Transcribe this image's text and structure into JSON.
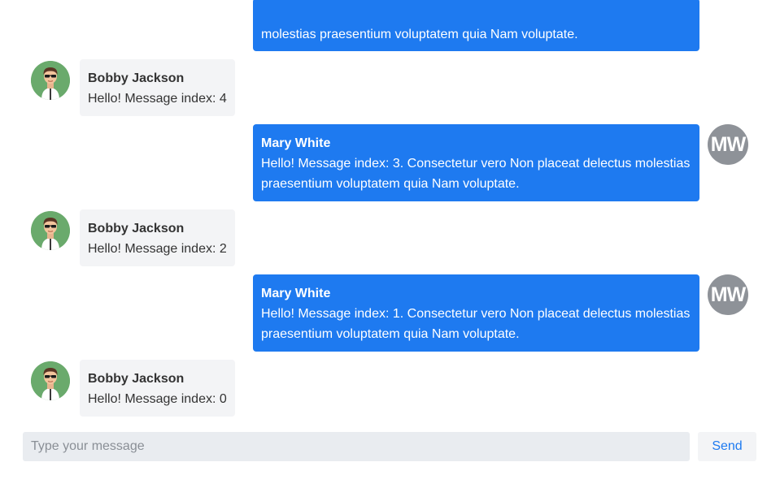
{
  "messages": [
    {
      "author": "",
      "text": "molestias praesentium voluptatem quia Nam voluptate.",
      "from_me": true
    },
    {
      "author": "Bobby Jackson",
      "text": "Hello! Message index: 4",
      "from_me": false
    },
    {
      "author": "Mary White",
      "text": "Hello! Message index: 3. Consectetur vero Non placeat delectus molestias praesentium voluptatem quia Nam voluptate.",
      "from_me": true,
      "avatar_initials": "MW"
    },
    {
      "author": "Bobby Jackson",
      "text": "Hello! Message index: 2",
      "from_me": false
    },
    {
      "author": "Mary White",
      "text": "Hello! Message index: 1. Consectetur vero Non placeat delectus molestias praesentium voluptatem quia Nam voluptate.",
      "from_me": true,
      "avatar_initials": "MW"
    },
    {
      "author": "Bobby Jackson",
      "text": "Hello! Message index: 0",
      "from_me": false
    }
  ],
  "composer": {
    "placeholder": "Type your message",
    "value": "",
    "send_label": "Send"
  },
  "colors": {
    "outgoing_bubble": "#1e7af0",
    "incoming_bubble": "#f3f4f6",
    "initials_avatar": "#8e9298",
    "user_avatar_bg": "#6aaa6c"
  }
}
